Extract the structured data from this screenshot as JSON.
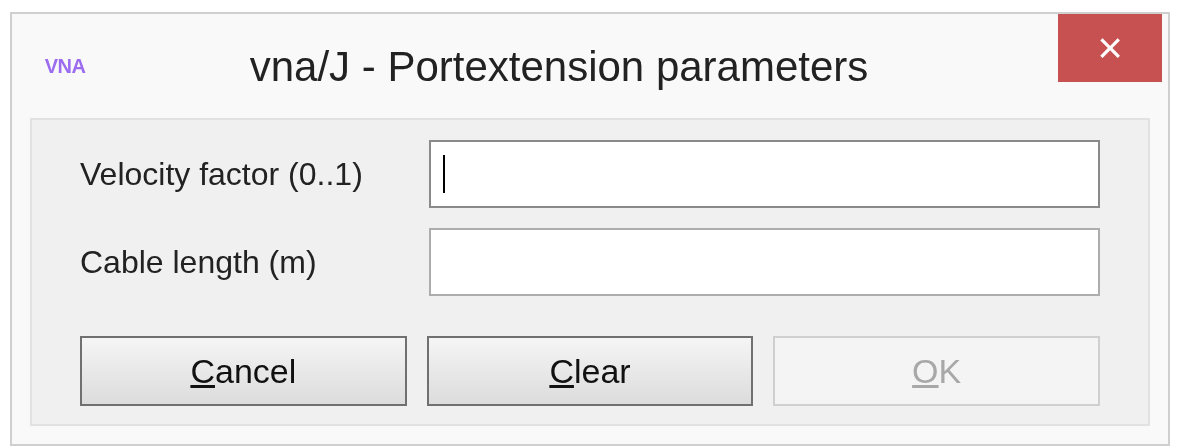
{
  "window": {
    "title": "vna/J - Portextension parameters",
    "logo": "VNA",
    "close": "×"
  },
  "fields": [
    {
      "label": "Velocity factor (0..1)",
      "focused": true
    },
    {
      "label": "Cable length (m)",
      "focused": false
    }
  ],
  "buttons": [
    {
      "label": "Cancel",
      "disabled": false
    },
    {
      "label": "Clear",
      "disabled": false
    },
    {
      "label": "OK",
      "disabled": true
    }
  ]
}
